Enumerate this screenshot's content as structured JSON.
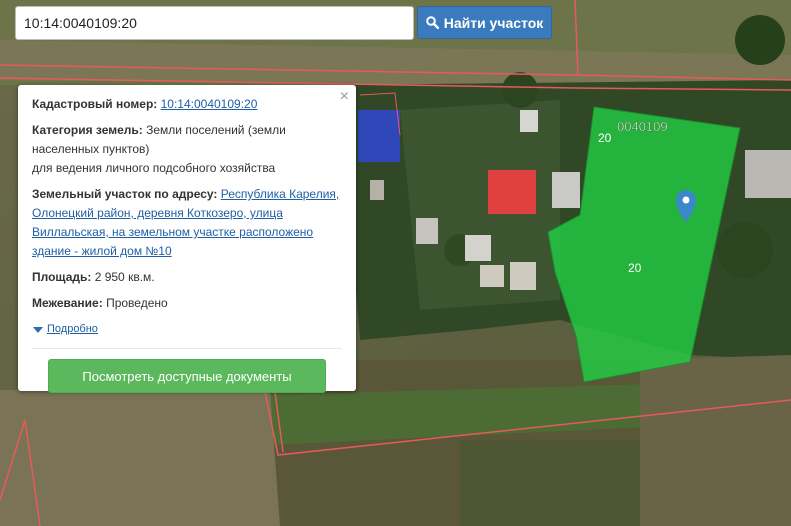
{
  "search": {
    "value": "10:14:0040109:20",
    "button_label": "Найти участок",
    "button_icon": "search-icon"
  },
  "info_card": {
    "cadastral_label": "Кадастровый номер:",
    "cadastral_value": "10:14:0040109:20",
    "category_label": "Категория земель:",
    "category_value_1": "Земли поселений (земли",
    "category_value_2": "населенных пунктов)",
    "category_value_3": "для ведения личного подсобного хозяйства",
    "address_label": "Земельный участок по адресу:",
    "address_value_1": "Республика Карелия,",
    "address_value_2": "Олонецкий район, деревня Коткозеро, улица",
    "address_value_3": "Виллальская, на земельном участке расположено",
    "address_value_4": "здание - жилой дом №10",
    "area_label": "Площадь:",
    "area_value": "2 950 кв.м.",
    "survey_label": "Межевание:",
    "survey_value": "Проведено",
    "details_label": "Подробно",
    "docs_button_label": "Посмотреть доступные документы",
    "close_label": "×"
  },
  "map": {
    "block_label": "0040109",
    "parcel_label_top": "20",
    "parcel_label_center": "20",
    "parcel_color": "#22cc44",
    "boundary_color": "#e85a5a",
    "marker_color": "#3a88c8"
  }
}
